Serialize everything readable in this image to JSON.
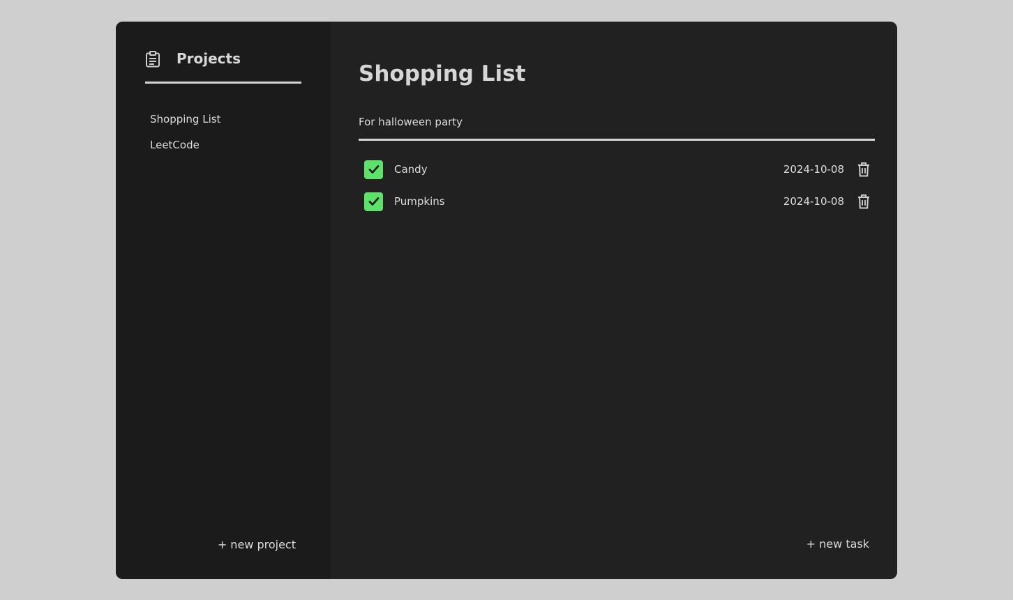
{
  "sidebar": {
    "title": "Projects",
    "header_icon": "clipboard-icon",
    "projects": [
      {
        "label": "Shopping List"
      },
      {
        "label": "LeetCode"
      }
    ],
    "new_project_label": "+ new project"
  },
  "main": {
    "title": "Shopping List",
    "description": "For halloween party",
    "tasks": [
      {
        "name": "Candy",
        "date": "2024-10-08",
        "done": true
      },
      {
        "name": "Pumpkins",
        "date": "2024-10-08",
        "done": true
      }
    ],
    "new_task_label": "+ new task"
  },
  "colors": {
    "page_bg": "#cfcfcf",
    "sidebar_bg": "#1b1b1b",
    "main_bg": "#212121",
    "checkbox_green": "#5ee36a",
    "text": "#dcdcdc"
  }
}
